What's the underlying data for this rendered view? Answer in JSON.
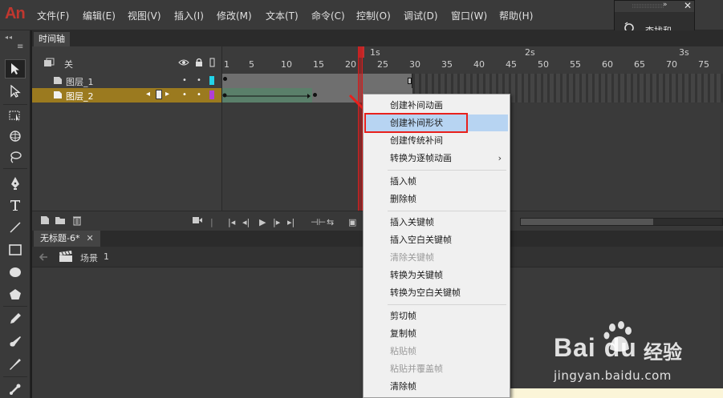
{
  "app": {
    "logo": "An"
  },
  "menu": [
    "文件(F)",
    "编辑(E)",
    "视图(V)",
    "插入(I)",
    "修改(M)",
    "文本(T)",
    "命令(C)",
    "控制(O)",
    "调试(D)",
    "窗口(W)",
    "帮助(H)"
  ],
  "find_panel": {
    "collapse": "»",
    "close": "✕",
    "label": "查找和..."
  },
  "toolbar": {
    "grip": "◂◂",
    "menu": "≡",
    "tools": [
      "selection-tool",
      "subselection-tool",
      "free-transform-tool",
      "3d-rotation-tool",
      "lasso-tool",
      "pen-tool",
      "text-tool",
      "line-tool",
      "rectangle-tool",
      "oval-tool",
      "polystar-tool",
      "pencil-tool",
      "brush-tool",
      "paint-brush-tool",
      "bone-tool"
    ]
  },
  "timeline": {
    "tab_label": "时间轴",
    "header_label": "关",
    "layers": [
      {
        "name": "图层_1",
        "color": "#22d3e8",
        "selected": false
      },
      {
        "name": "图层_2",
        "color": "#b03fd6",
        "selected": true
      }
    ],
    "ruler": {
      "frames": [
        "1",
        "5",
        "10",
        "15",
        "20",
        "25",
        "30",
        "35",
        "40",
        "45",
        "50",
        "55",
        "60",
        "65",
        "70",
        "75"
      ],
      "seconds": [
        "1s",
        "2s",
        "3s"
      ]
    },
    "current_frame": 22,
    "footer_controls": [
      "new-layer",
      "new-folder",
      "delete-layer",
      "camera",
      "first-frame",
      "prev-frame",
      "play",
      "next-frame",
      "last-frame",
      "loop",
      "onion-skin"
    ]
  },
  "document": {
    "tab_label": "无标题-6*",
    "tab_close": "✕",
    "scene_label": "场景",
    "scene_number": "1"
  },
  "context_menu": {
    "items": [
      {
        "label": "创建补间动画",
        "enabled": true
      },
      {
        "label": "创建补间形状",
        "enabled": true,
        "hovered": true
      },
      {
        "label": "创建传统补间",
        "enabled": true
      },
      {
        "label": "转换为逐帧动画",
        "enabled": true,
        "submenu": true,
        "submenu_arrow": "›"
      },
      {
        "separator": true
      },
      {
        "label": "插入帧",
        "enabled": true
      },
      {
        "label": "删除帧",
        "enabled": true
      },
      {
        "separator": true
      },
      {
        "label": "插入关键帧",
        "enabled": true
      },
      {
        "label": "插入空白关键帧",
        "enabled": true
      },
      {
        "label": "清除关键帧",
        "enabled": false
      },
      {
        "label": "转换为关键帧",
        "enabled": true
      },
      {
        "label": "转换为空白关键帧",
        "enabled": true
      },
      {
        "separator": true
      },
      {
        "label": "剪切帧",
        "enabled": true
      },
      {
        "label": "复制帧",
        "enabled": true
      },
      {
        "label": "粘贴帧",
        "enabled": false
      },
      {
        "label": "粘贴并覆盖帧",
        "enabled": false
      },
      {
        "label": "清除帧",
        "enabled": true
      }
    ]
  },
  "colors": {
    "selected_layer": "#9b7a1f",
    "tween_span": "#5a7f6a",
    "playhead": "#d02020",
    "annotation": "#e8201c"
  },
  "watermark": {
    "brand": "Bai du",
    "brand_cn": "经验",
    "url": "jingyan.baidu.com"
  }
}
